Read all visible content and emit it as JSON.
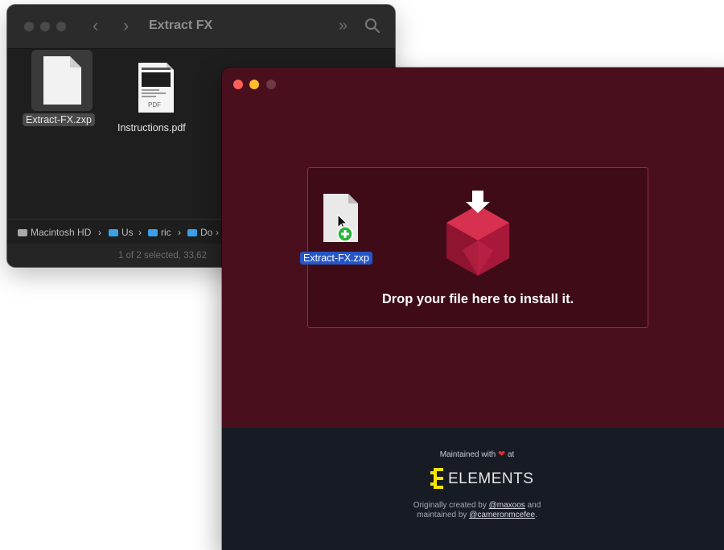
{
  "finder": {
    "title": "Extract FX",
    "files": [
      {
        "name": "Extract-FX.zxp",
        "icon": "document-icon",
        "selected": true
      },
      {
        "name": "Instructions.pdf",
        "icon": "pdf-icon",
        "pdf_badge": "PDF",
        "selected": false
      }
    ],
    "path": [
      {
        "label": "Macintosh HD",
        "icon": "hard-drive-icon"
      },
      {
        "label": "Us",
        "icon": "folder-icon"
      },
      {
        "label": "ric",
        "icon": "folder-icon"
      },
      {
        "label": "Do",
        "icon": "folder-icon"
      }
    ],
    "status": "1 of 2 selected, 33,62"
  },
  "installer": {
    "drop_text": "Drop your file here to install it.",
    "dragged_file": "Extract-FX.zxp",
    "footer": {
      "maintained_prefix": "Maintained with",
      "maintained_suffix": "at",
      "brand": "ELEMENTS",
      "originally_prefix": "Originally created by",
      "author1": "@maxoos",
      "and": "and",
      "maintained_by": "maintained by",
      "author2": "@cameronmcefee",
      "end": "."
    }
  },
  "colors": {
    "installer_bg": "#4a0f1d",
    "drop_border": "#a0283f",
    "footer_bg": "#171b23",
    "brand_yellow": "#f5e500",
    "selection_blue": "#2556c8"
  }
}
